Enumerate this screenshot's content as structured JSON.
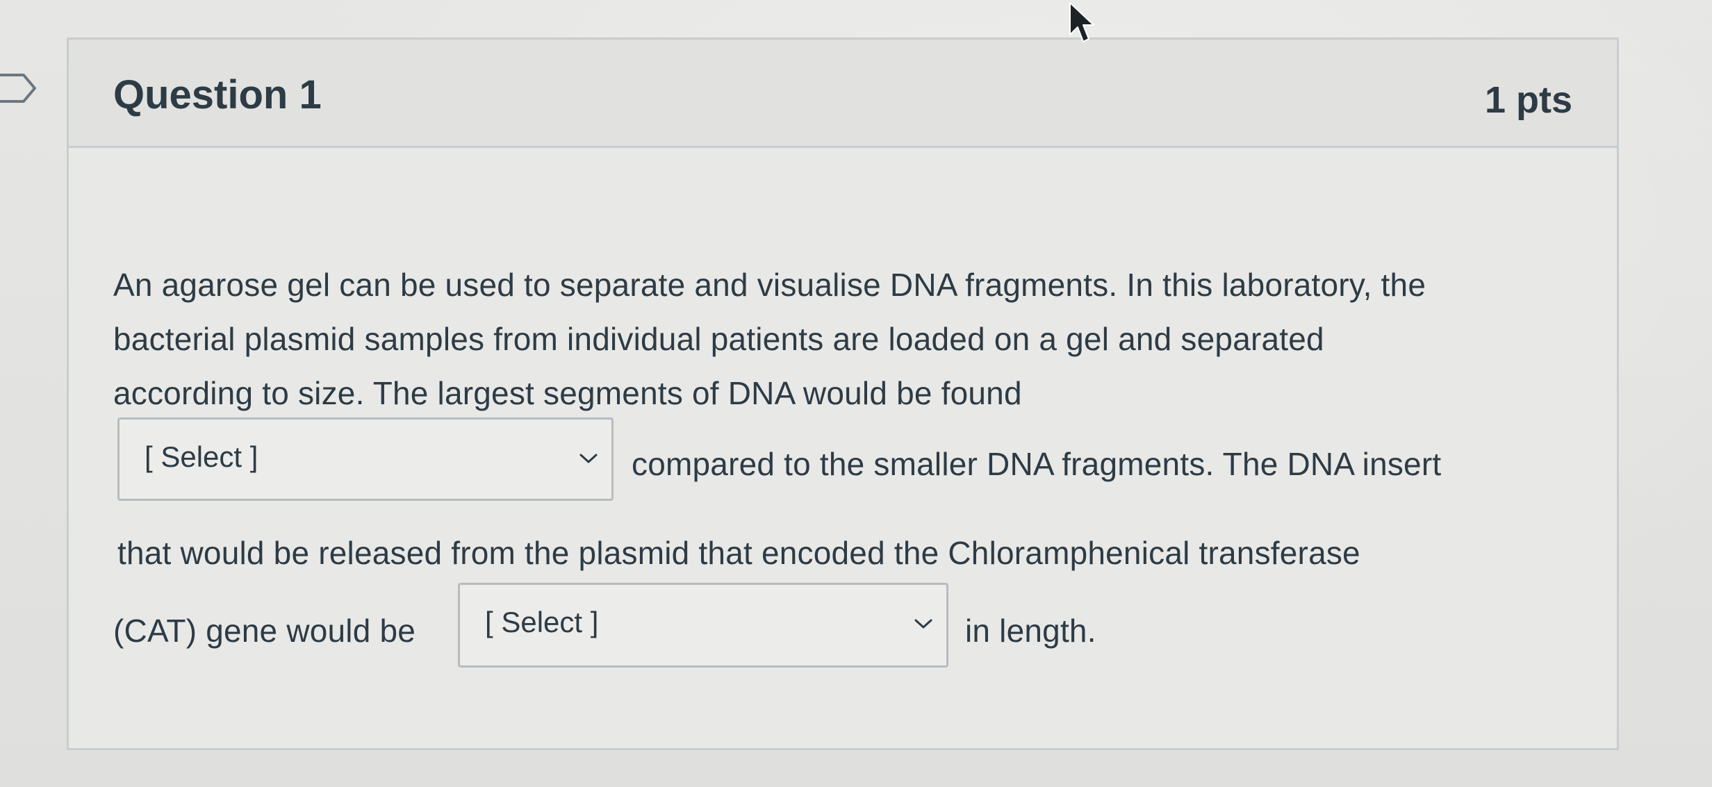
{
  "question": {
    "title": "Question 1",
    "points": "1 pts",
    "lines": {
      "l1": "An agarose gel can be used to separate and visualise DNA fragments.  In this laboratory, the",
      "l2": "bacterial plasmid samples from individual patients are loaded on a gel and separated",
      "l3": "according to size.  The largest segments of DNA would be found",
      "l4": "compared to the smaller DNA fragments.  The DNA insert",
      "l5": "that would be released from the plasmid that encoded the Chloramphenical transferase",
      "l6a": "(CAT) gene would be",
      "l6b": "in length."
    },
    "dropdown1": {
      "value": "[ Select ]"
    },
    "dropdown2": {
      "value": "[ Select ]"
    }
  },
  "icons": {
    "flag": "question-flag-icon",
    "chevron": "chevron-down-icon",
    "cursor": "mouse-pointer-icon"
  },
  "colors": {
    "text": "#2d3b45",
    "border": "#c7cdd1",
    "header_bg": "#e1e1df"
  }
}
